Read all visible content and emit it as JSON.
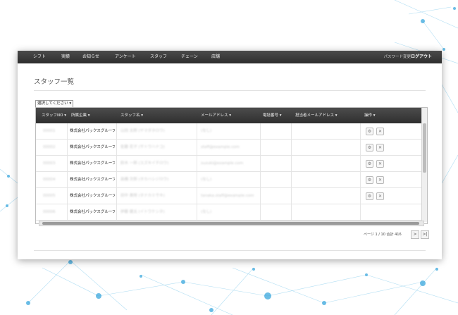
{
  "nav": {
    "items": [
      "シフト",
      "実績",
      "お知らせ",
      "アンケート",
      "スタッフ",
      "チェーン",
      "店舗"
    ],
    "password_change": "パスワード変更",
    "logout": "ログアウト"
  },
  "page": {
    "title": "スタッフ一覧"
  },
  "filter": {
    "select_value": "選択してください"
  },
  "table": {
    "headers": [
      "スタッフNO ▾",
      "所属企業 ▾",
      "スタッフ名 ▾",
      "メールアドレス ▾",
      "電話番号 ▾",
      "担当者メールアドレス ▾",
      "操作 ▾"
    ],
    "rows": [
      {
        "no": "00001",
        "company": "株式会社パックスグループ",
        "name": "山田 太郎 (ヤマダタロウ)",
        "email": "(なし)"
      },
      {
        "no": "00002",
        "company": "株式会社パックスグループ",
        "name": "佐藤 花子 (サトウハナコ)",
        "email": "staff@example.com"
      },
      {
        "no": "00003",
        "company": "株式会社パックスグループ",
        "name": "鈴木 一郎 (スズキイチロウ)",
        "email": "suzuki@example.com"
      },
      {
        "no": "00004",
        "company": "株式会社パックスグループ",
        "name": "高橋 次郎 (タカハシジロウ)",
        "email": "(なし)"
      },
      {
        "no": "00005",
        "company": "株式会社パックスグループ",
        "name": "田中 美咲 (タナカミサキ)",
        "email": "tanaka.staff@example.com"
      },
      {
        "no": "00006",
        "company": "株式会社パックスグループ",
        "name": "伊藤 健太 (イトウケンタ)",
        "email": "(なし)"
      }
    ]
  },
  "pager": {
    "text": "ページ 1 / 10 合計 416",
    "next": ">",
    "last": ">|"
  },
  "icons": {
    "edit": "gear-icon",
    "delete": "close-icon"
  }
}
